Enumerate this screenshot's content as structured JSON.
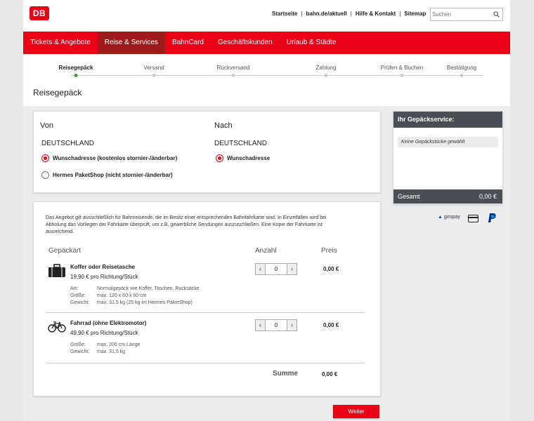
{
  "header": {
    "logo": "DB",
    "links": [
      "Startseite",
      "bahn.de/aktuell",
      "Hilfe & Kontakt",
      "Sitemap"
    ],
    "search_placeholder": "Suchen"
  },
  "nav": [
    "Tickets & Angebote",
    "Reise & Services",
    "BahnCard",
    "Geschäftskunden",
    "Urlaub & Städte"
  ],
  "nav_active": 1,
  "steps": [
    "Reisegepäck",
    "Versand",
    "Rückversand",
    "Zahlung",
    "Prüfen & Buchen",
    "Bestätigung"
  ],
  "step_active": 0,
  "page_title": "Reisegepäck",
  "route": {
    "von_label": "Von",
    "nach_label": "Nach",
    "von_country": "DEUTSCHLAND",
    "nach_country": "DEUTSCHLAND",
    "von_options": [
      {
        "label": "Wunschadresse (kostenlos stornier-/änderbar)",
        "selected": true
      },
      {
        "label": "Hermes PaketShop (nicht stornier-/änderbar)",
        "selected": false
      }
    ],
    "nach_options": [
      {
        "label": "Wunschadresse",
        "selected": true
      }
    ]
  },
  "info": {
    "line1": "Das Angebot gilt ausschließlich für Bahnreisende, die im Besitz einer entsprechenden Bahnfahrkarte sind. In Einzelfällen wird bei",
    "line2": "Abholung das Vorliegen der Fahrkarte überprüft, um z.B. gewerbliche Sendungen auszuschließen. Eine Kopie der Fahrkarte ist",
    "line3": "ausreichend."
  },
  "table": {
    "col_art": "Gepäckart",
    "col_anzahl": "Anzahl",
    "col_preis": "Preis",
    "items": [
      {
        "icon": "suitcase-icon",
        "name": "Koffer oder Reisetasche",
        "price": "19,90 € pro Richtung/Stück",
        "qty": "0",
        "total": "0,00 €",
        "details": [
          {
            "k": "Art:",
            "v": "Normalgepäck wie Koffer, Taschen, Rucksäcke"
          },
          {
            "k": "Größe:",
            "v": "max. 120 x 60 x 60 cm"
          },
          {
            "k": "Gewicht:",
            "v": "max. 31,5 kg (25 kg im Hermes PaketShop)"
          }
        ]
      },
      {
        "icon": "bicycle-icon",
        "name": "Fahrrad (ohne Elektromotor)",
        "price": "49,90 € pro Richtung/Stück",
        "qty": "0",
        "total": "0,00 €",
        "details": [
          {
            "k": "Größe:",
            "v": "max. 200 cm Länge"
          },
          {
            "k": "Gewicht:",
            "v": "max. 31,5 kg"
          }
        ]
      }
    ],
    "summe_label": "Summe",
    "summe_value": "0,00 €"
  },
  "sidebar": {
    "title": "Ihr Gepäckservice:",
    "empty": "Keine Gepäckstücke gewählt",
    "total_label": "Gesamt",
    "total_value": "0,00 €",
    "payments": [
      "giropay",
      "card-icon",
      "paypal-icon"
    ],
    "giropay_label": "giropay"
  },
  "weiter_label": "Weiter",
  "colors": {
    "accent": "#ec0016",
    "dark": "#4a4f55",
    "active_nav": "#9e1b1b",
    "step_done": "#3a9b3a"
  }
}
